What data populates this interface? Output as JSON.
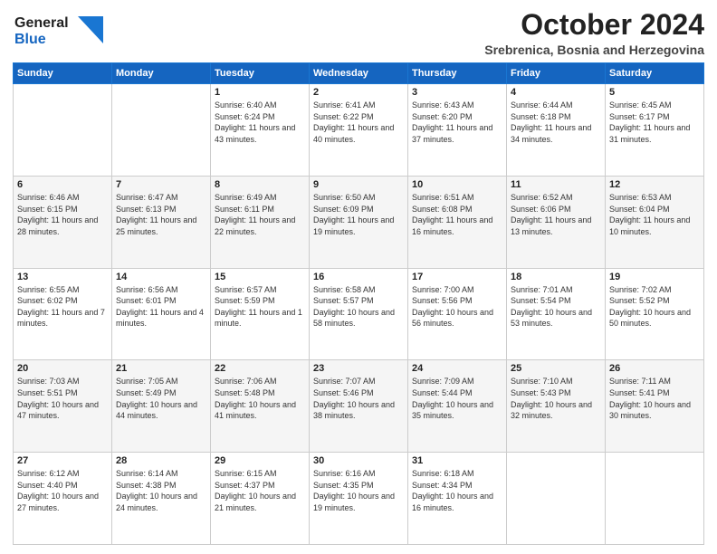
{
  "header": {
    "logo_line1": "General",
    "logo_line2": "Blue",
    "month": "October 2024",
    "location": "Srebrenica, Bosnia and Herzegovina"
  },
  "days_of_week": [
    "Sunday",
    "Monday",
    "Tuesday",
    "Wednesday",
    "Thursday",
    "Friday",
    "Saturday"
  ],
  "weeks": [
    [
      {
        "day": "",
        "info": ""
      },
      {
        "day": "",
        "info": ""
      },
      {
        "day": "1",
        "info": "Sunrise: 6:40 AM\nSunset: 6:24 PM\nDaylight: 11 hours and 43 minutes."
      },
      {
        "day": "2",
        "info": "Sunrise: 6:41 AM\nSunset: 6:22 PM\nDaylight: 11 hours and 40 minutes."
      },
      {
        "day": "3",
        "info": "Sunrise: 6:43 AM\nSunset: 6:20 PM\nDaylight: 11 hours and 37 minutes."
      },
      {
        "day": "4",
        "info": "Sunrise: 6:44 AM\nSunset: 6:18 PM\nDaylight: 11 hours and 34 minutes."
      },
      {
        "day": "5",
        "info": "Sunrise: 6:45 AM\nSunset: 6:17 PM\nDaylight: 11 hours and 31 minutes."
      }
    ],
    [
      {
        "day": "6",
        "info": "Sunrise: 6:46 AM\nSunset: 6:15 PM\nDaylight: 11 hours and 28 minutes."
      },
      {
        "day": "7",
        "info": "Sunrise: 6:47 AM\nSunset: 6:13 PM\nDaylight: 11 hours and 25 minutes."
      },
      {
        "day": "8",
        "info": "Sunrise: 6:49 AM\nSunset: 6:11 PM\nDaylight: 11 hours and 22 minutes."
      },
      {
        "day": "9",
        "info": "Sunrise: 6:50 AM\nSunset: 6:09 PM\nDaylight: 11 hours and 19 minutes."
      },
      {
        "day": "10",
        "info": "Sunrise: 6:51 AM\nSunset: 6:08 PM\nDaylight: 11 hours and 16 minutes."
      },
      {
        "day": "11",
        "info": "Sunrise: 6:52 AM\nSunset: 6:06 PM\nDaylight: 11 hours and 13 minutes."
      },
      {
        "day": "12",
        "info": "Sunrise: 6:53 AM\nSunset: 6:04 PM\nDaylight: 11 hours and 10 minutes."
      }
    ],
    [
      {
        "day": "13",
        "info": "Sunrise: 6:55 AM\nSunset: 6:02 PM\nDaylight: 11 hours and 7 minutes."
      },
      {
        "day": "14",
        "info": "Sunrise: 6:56 AM\nSunset: 6:01 PM\nDaylight: 11 hours and 4 minutes."
      },
      {
        "day": "15",
        "info": "Sunrise: 6:57 AM\nSunset: 5:59 PM\nDaylight: 11 hours and 1 minute."
      },
      {
        "day": "16",
        "info": "Sunrise: 6:58 AM\nSunset: 5:57 PM\nDaylight: 10 hours and 58 minutes."
      },
      {
        "day": "17",
        "info": "Sunrise: 7:00 AM\nSunset: 5:56 PM\nDaylight: 10 hours and 56 minutes."
      },
      {
        "day": "18",
        "info": "Sunrise: 7:01 AM\nSunset: 5:54 PM\nDaylight: 10 hours and 53 minutes."
      },
      {
        "day": "19",
        "info": "Sunrise: 7:02 AM\nSunset: 5:52 PM\nDaylight: 10 hours and 50 minutes."
      }
    ],
    [
      {
        "day": "20",
        "info": "Sunrise: 7:03 AM\nSunset: 5:51 PM\nDaylight: 10 hours and 47 minutes."
      },
      {
        "day": "21",
        "info": "Sunrise: 7:05 AM\nSunset: 5:49 PM\nDaylight: 10 hours and 44 minutes."
      },
      {
        "day": "22",
        "info": "Sunrise: 7:06 AM\nSunset: 5:48 PM\nDaylight: 10 hours and 41 minutes."
      },
      {
        "day": "23",
        "info": "Sunrise: 7:07 AM\nSunset: 5:46 PM\nDaylight: 10 hours and 38 minutes."
      },
      {
        "day": "24",
        "info": "Sunrise: 7:09 AM\nSunset: 5:44 PM\nDaylight: 10 hours and 35 minutes."
      },
      {
        "day": "25",
        "info": "Sunrise: 7:10 AM\nSunset: 5:43 PM\nDaylight: 10 hours and 32 minutes."
      },
      {
        "day": "26",
        "info": "Sunrise: 7:11 AM\nSunset: 5:41 PM\nDaylight: 10 hours and 30 minutes."
      }
    ],
    [
      {
        "day": "27",
        "info": "Sunrise: 6:12 AM\nSunset: 4:40 PM\nDaylight: 10 hours and 27 minutes."
      },
      {
        "day": "28",
        "info": "Sunrise: 6:14 AM\nSunset: 4:38 PM\nDaylight: 10 hours and 24 minutes."
      },
      {
        "day": "29",
        "info": "Sunrise: 6:15 AM\nSunset: 4:37 PM\nDaylight: 10 hours and 21 minutes."
      },
      {
        "day": "30",
        "info": "Sunrise: 6:16 AM\nSunset: 4:35 PM\nDaylight: 10 hours and 19 minutes."
      },
      {
        "day": "31",
        "info": "Sunrise: 6:18 AM\nSunset: 4:34 PM\nDaylight: 10 hours and 16 minutes."
      },
      {
        "day": "",
        "info": ""
      },
      {
        "day": "",
        "info": ""
      }
    ]
  ]
}
